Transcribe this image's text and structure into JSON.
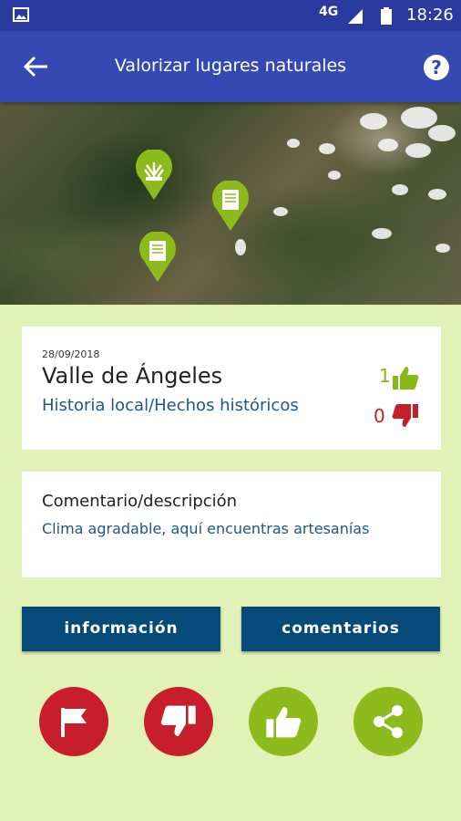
{
  "status_bar": {
    "network": "4G",
    "time": "18:26"
  },
  "app_bar": {
    "title": "Valorizar lugares naturales"
  },
  "map": {
    "pins": [
      {
        "icon": "plant-icon",
        "color": "#8dbb1c"
      },
      {
        "icon": "book-icon",
        "color": "#8dbb1c"
      },
      {
        "icon": "book-icon",
        "color": "#8dbb1c"
      }
    ]
  },
  "place_card": {
    "date": "28/09/2018",
    "name": "Valle de Ángeles",
    "category": "Historia local/Hechos históricos",
    "likes": "1",
    "dislikes": "0"
  },
  "comment_card": {
    "title": "Comentario/descripción",
    "text": "Clima agradable, aquí encuentras artesanías"
  },
  "buttons": {
    "info": "información",
    "comments": "comentarios"
  },
  "actions": [
    "report-flag",
    "dislike",
    "like",
    "share"
  ],
  "colors": {
    "primary": "#3549b4",
    "status": "#2b3a9e",
    "green": "#8dbb1c",
    "red": "#c81e2c",
    "navy": "#064a7a",
    "background": "#e2f1b6"
  }
}
